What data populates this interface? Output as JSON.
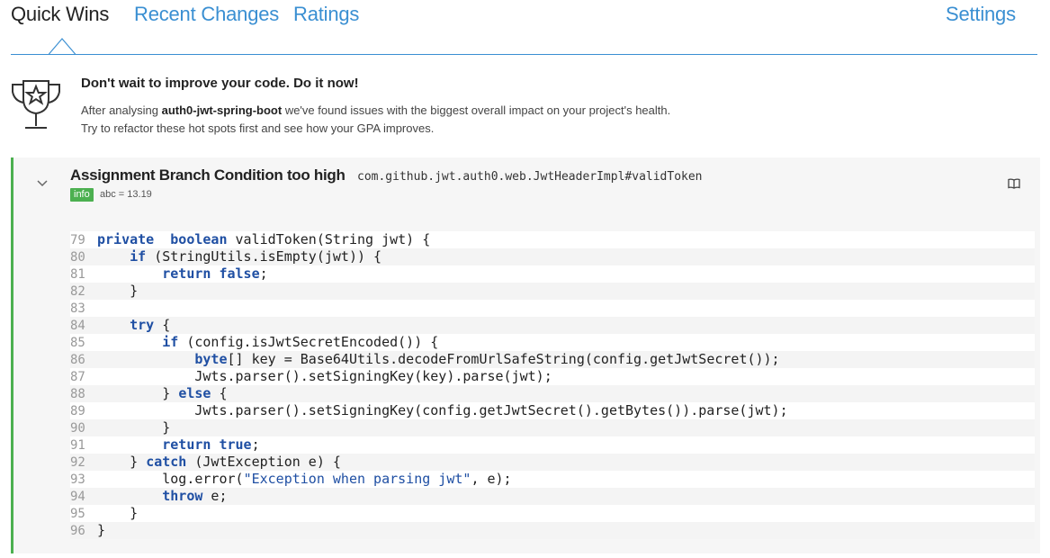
{
  "nav": {
    "tabs": [
      "Quick Wins",
      "Recent Changes",
      "Ratings"
    ],
    "settings": "Settings"
  },
  "intro": {
    "icon": "trophy-star-icon",
    "title": "Don't wait to improve your code. Do it now!",
    "line1_prefix": "After analysing ",
    "project": "auth0-jwt-spring-boot",
    "line1_suffix": " we've found issues with the biggest overall impact on your project's health.",
    "line2": "Try to refactor these hot spots first and see how your GPA improves."
  },
  "issue": {
    "title": "Assignment Branch Condition too high",
    "location": "com.github.jwt.auth0.web.JwtHeaderImpl#validToken",
    "badge": "info",
    "metric": "abc = 13.19",
    "status_color": "#4cb050",
    "icons": {
      "toggle": "chevron-down-icon",
      "docs": "book-icon"
    }
  },
  "code": {
    "lines": [
      {
        "n": "79",
        "t": [
          [
            "kw",
            "private"
          ],
          [
            "",
            "  "
          ],
          [
            "kw",
            "boolean"
          ],
          [
            "",
            " validToken(String jwt) {"
          ]
        ]
      },
      {
        "n": "80",
        "t": [
          [
            "",
            "    "
          ],
          [
            "kw",
            "if"
          ],
          [
            "",
            " (StringUtils.isEmpty(jwt)) {"
          ]
        ]
      },
      {
        "n": "81",
        "t": [
          [
            "",
            "        "
          ],
          [
            "kw",
            "return"
          ],
          [
            "",
            " "
          ],
          [
            "kw",
            "false"
          ],
          [
            "",
            ";"
          ]
        ]
      },
      {
        "n": "82",
        "t": [
          [
            "",
            "    }"
          ]
        ]
      },
      {
        "n": "83",
        "t": [
          [
            "",
            ""
          ]
        ]
      },
      {
        "n": "84",
        "t": [
          [
            "",
            "    "
          ],
          [
            "kw",
            "try"
          ],
          [
            "",
            " {"
          ]
        ]
      },
      {
        "n": "85",
        "t": [
          [
            "",
            "        "
          ],
          [
            "kw",
            "if"
          ],
          [
            "",
            " (config.isJwtSecretEncoded()) {"
          ]
        ]
      },
      {
        "n": "86",
        "t": [
          [
            "",
            "            "
          ],
          [
            "kw",
            "byte"
          ],
          [
            "",
            "[] key = Base64Utils.decodeFromUrlSafeString(config.getJwtSecret());"
          ]
        ]
      },
      {
        "n": "87",
        "t": [
          [
            "",
            "            Jwts.parser().setSigningKey(key).parse(jwt);"
          ]
        ]
      },
      {
        "n": "88",
        "t": [
          [
            "",
            "        } "
          ],
          [
            "kw",
            "else"
          ],
          [
            "",
            " {"
          ]
        ]
      },
      {
        "n": "89",
        "t": [
          [
            "",
            "            Jwts.parser().setSigningKey(config.getJwtSecret().getBytes()).parse(jwt);"
          ]
        ]
      },
      {
        "n": "90",
        "t": [
          [
            "",
            "        }"
          ]
        ]
      },
      {
        "n": "91",
        "t": [
          [
            "",
            "        "
          ],
          [
            "kw",
            "return"
          ],
          [
            "",
            " "
          ],
          [
            "kw",
            "true"
          ],
          [
            "",
            ";"
          ]
        ]
      },
      {
        "n": "92",
        "t": [
          [
            "",
            "    } "
          ],
          [
            "kw",
            "catch"
          ],
          [
            "",
            " (JwtException e) {"
          ]
        ]
      },
      {
        "n": "93",
        "t": [
          [
            "",
            "        log.error("
          ],
          [
            "str",
            "\"Exception when parsing jwt\""
          ],
          [
            "",
            ", e);"
          ]
        ]
      },
      {
        "n": "94",
        "t": [
          [
            "",
            "        "
          ],
          [
            "kw",
            "throw"
          ],
          [
            "",
            " e;"
          ]
        ]
      },
      {
        "n": "95",
        "t": [
          [
            "",
            "    }"
          ]
        ]
      },
      {
        "n": "96",
        "t": [
          [
            "",
            "}"
          ]
        ]
      }
    ]
  }
}
